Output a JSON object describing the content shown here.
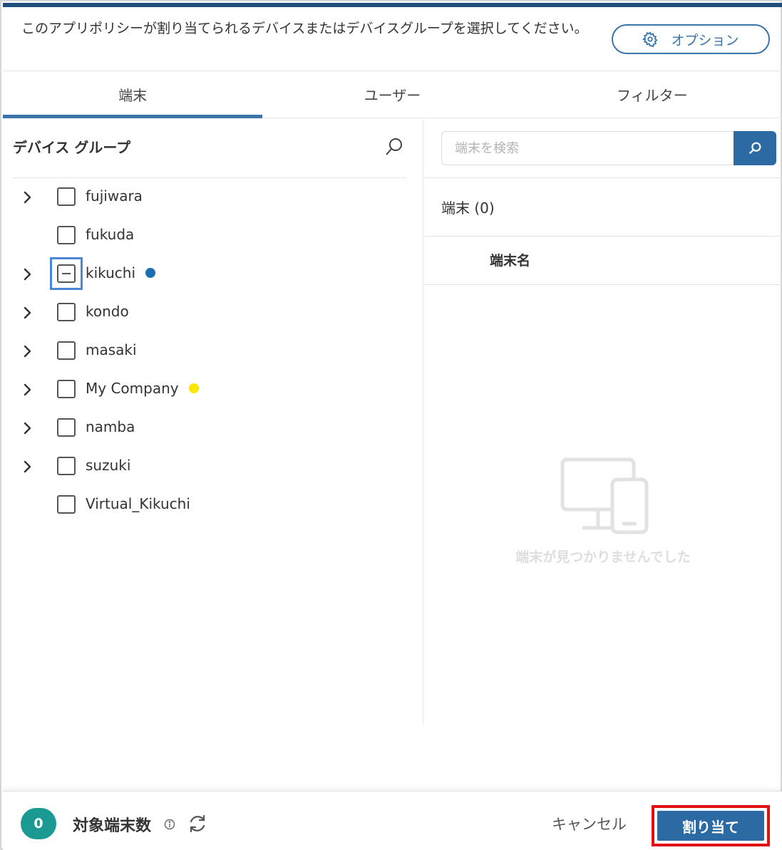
{
  "header": {
    "instruction": "このアプリポリシーが割り当てられるデバイスまたはデバイスグループを選択してください。",
    "options_label": "オプション"
  },
  "tabs": [
    {
      "label": "端末",
      "active": true
    },
    {
      "label": "ユーザー",
      "active": false
    },
    {
      "label": "フィルター",
      "active": false
    }
  ],
  "device_groups": {
    "title": "デバイス グループ",
    "items": [
      {
        "label": "fujiwara",
        "expandable": true,
        "state": "unchecked",
        "dot": ""
      },
      {
        "label": "fukuda",
        "expandable": false,
        "state": "unchecked",
        "dot": ""
      },
      {
        "label": "kikuchi",
        "expandable": true,
        "state": "indeterminate",
        "dot": "#1a6fb0"
      },
      {
        "label": "kondo",
        "expandable": true,
        "state": "unchecked",
        "dot": ""
      },
      {
        "label": "masaki",
        "expandable": true,
        "state": "unchecked",
        "dot": ""
      },
      {
        "label": "My Company",
        "expandable": true,
        "state": "unchecked",
        "dot": "#ffe600"
      },
      {
        "label": "namba",
        "expandable": true,
        "state": "unchecked",
        "dot": ""
      },
      {
        "label": "suzuki",
        "expandable": true,
        "state": "unchecked",
        "dot": ""
      },
      {
        "label": "Virtual_Kikuchi",
        "expandable": false,
        "state": "unchecked",
        "dot": ""
      }
    ]
  },
  "devices": {
    "search_placeholder": "端末を検索",
    "count_label": "端末 (0)",
    "column_name": "端末名",
    "empty_message": "端末が見つかりませんでした"
  },
  "footer": {
    "target_count": "0",
    "target_label": "対象端末数",
    "cancel_label": "キャンセル",
    "assign_label": "割り当て"
  },
  "colors": {
    "accent": "#2c6aa3",
    "badge": "#1b9a93",
    "highlight": "#e01010"
  }
}
